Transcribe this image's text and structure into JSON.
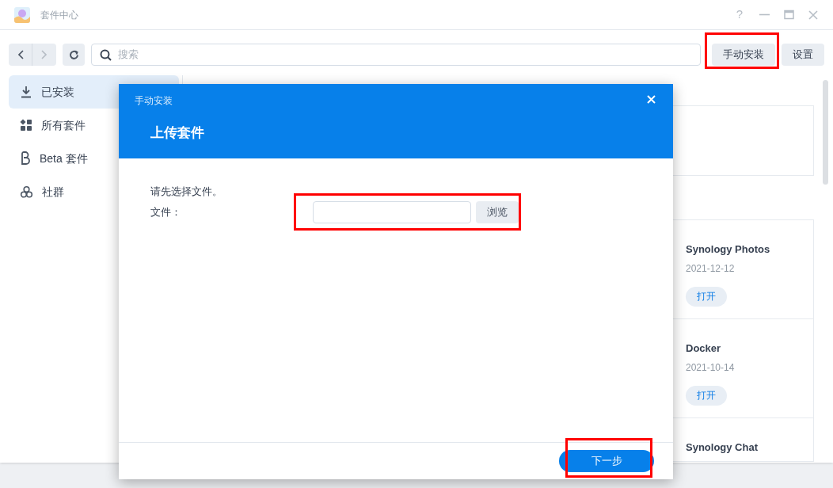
{
  "window": {
    "title": "套件中心",
    "controls": [
      "?"
    ]
  },
  "toolbar": {
    "search": {
      "placeholder": "搜索"
    },
    "buttons": [
      {
        "label": "手动安装",
        "highlighted": true
      },
      {
        "label": "设置"
      }
    ]
  },
  "sidebar": {
    "items": [
      {
        "label": "已安装",
        "selected": true
      },
      {
        "label": "所有套件",
        "selected": false
      },
      {
        "label": "Beta 套件",
        "selected": false
      },
      {
        "label": "社群",
        "selected": false
      }
    ]
  },
  "packages": [
    {
      "name": "Synology Photos",
      "date": "2021-12-12",
      "action": "打开"
    },
    {
      "name": "Docker",
      "date": "2021-10-14",
      "action": "打开"
    },
    {
      "name": "Synology Chat"
    }
  ],
  "dialog": {
    "title": "手动安装",
    "heading": "上传套件",
    "message": "请先选择文件。",
    "file_label": "文件：",
    "file_highlighted": true,
    "browse": "浏览",
    "next": {
      "label": "下一步",
      "highlighted": true
    }
  }
}
